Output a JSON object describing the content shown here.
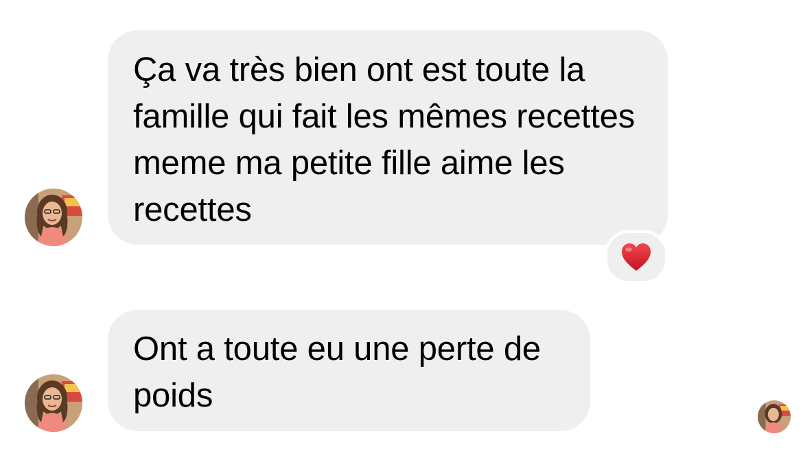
{
  "messages": [
    {
      "text": "Ça va très bien ont est toute la famille qui fait les mêmes recettes meme ma petite fille aime les recettes",
      "reaction": "heart-emoji"
    },
    {
      "text": "Ont a toute eu une perte de poids"
    }
  ],
  "colors": {
    "bubble": "#efefef",
    "text": "#000000",
    "heart": "#e0242f",
    "background": "#ffffff"
  },
  "icons": {
    "avatar": "profile-photo-icon",
    "read_receipt": "read-receipt-avatar-icon"
  }
}
